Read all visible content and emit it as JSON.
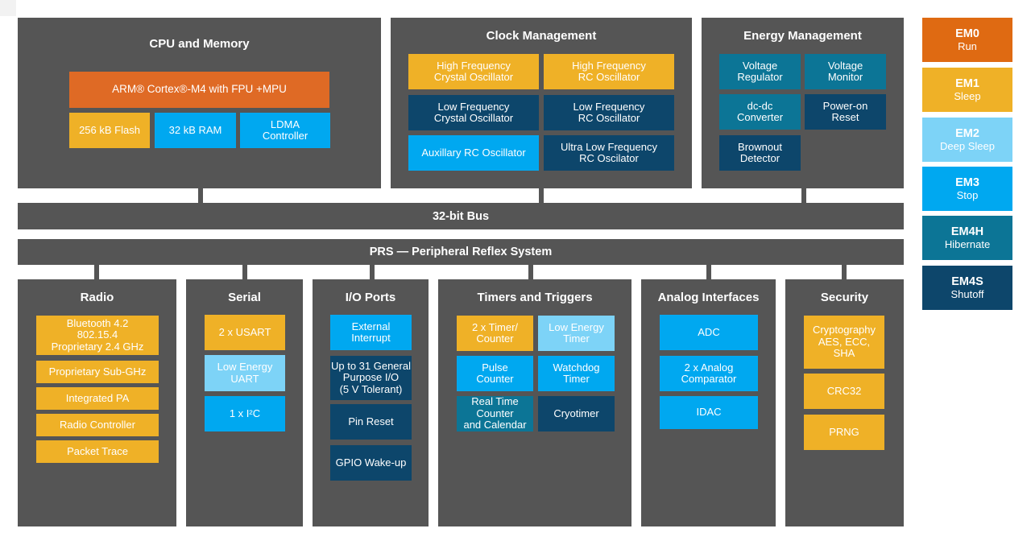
{
  "diagram": {
    "top_blocks": [
      {
        "title": "CPU and Memory",
        "tiles": [
          {
            "label": "ARM® Cortex®-M4 with FPU +MPU",
            "color": "#df6a25"
          },
          {
            "label": "256 kB Flash",
            "color": "#efb127"
          },
          {
            "label": "32 kB RAM",
            "color": "#00a8f0"
          },
          {
            "label": "LDMA\nController",
            "color": "#00a8f0"
          }
        ]
      },
      {
        "title": "Clock Management",
        "tiles": [
          {
            "label": "High Frequency\nCrystal Oscillator",
            "color": "#efb127"
          },
          {
            "label": "High Frequency\nRC Oscillator",
            "color": "#efb127"
          },
          {
            "label": "Low Frequency\nCrystal Oscillator",
            "color": "#0d466b"
          },
          {
            "label": "Low Frequency\nRC Oscillator",
            "color": "#0d466b"
          },
          {
            "label": "Auxillary RC Oscillator",
            "color": "#00a8f0"
          },
          {
            "label": "Ultra Low Frequency\nRC Oscilator",
            "color": "#0d466b"
          }
        ]
      },
      {
        "title": "Energy Management",
        "tiles": [
          {
            "label": "Voltage\nRegulator",
            "color": "#0c7596"
          },
          {
            "label": "Voltage\nMonitor",
            "color": "#0c7596"
          },
          {
            "label": "dc-dc\nConverter",
            "color": "#0c7596"
          },
          {
            "label": "Power-on\nReset",
            "color": "#0d466b"
          },
          {
            "label": "Brownout\nDetector",
            "color": "#0d466b"
          }
        ]
      }
    ],
    "bus_label": "32-bit Bus",
    "prs_label": "PRS — Peripheral Reflex System",
    "bottom_blocks": [
      {
        "title": "Radio",
        "tiles": [
          {
            "label": "Bluetooth 4.2\n802.15.4\nProprietary 2.4 GHz",
            "color": "#efb127"
          },
          {
            "label": "Proprietary Sub-GHz",
            "color": "#efb127"
          },
          {
            "label": "Integrated PA",
            "color": "#efb127"
          },
          {
            "label": "Radio Controller",
            "color": "#efb127"
          },
          {
            "label": "Packet Trace",
            "color": "#efb127"
          }
        ]
      },
      {
        "title": "Serial",
        "tiles": [
          {
            "label": "2 x USART",
            "color": "#efb127"
          },
          {
            "label": "Low Energy\nUART",
            "color": "#7dd3f7"
          },
          {
            "label": "1 x I²C",
            "color": "#00a8f0"
          }
        ]
      },
      {
        "title": "I/O Ports",
        "tiles": [
          {
            "label": "External\nInterrupt",
            "color": "#00a8f0"
          },
          {
            "label": "Up to 31 General\nPurpose I/O\n(5 V Tolerant)",
            "color": "#0d466b"
          },
          {
            "label": "Pin Reset",
            "color": "#0d466b"
          },
          {
            "label": "GPIO Wake-up",
            "color": "#0d466b"
          }
        ]
      },
      {
        "title": "Timers and Triggers",
        "tiles": [
          {
            "label": "2 x Timer/\nCounter",
            "color": "#efb127"
          },
          {
            "label": "Low Energy\nTimer",
            "color": "#7dd3f7"
          },
          {
            "label": "Pulse\nCounter",
            "color": "#00a8f0"
          },
          {
            "label": "Watchdog\nTimer",
            "color": "#00a8f0"
          },
          {
            "label": "Real Time\nCounter\nand Calendar",
            "color": "#0c7596"
          },
          {
            "label": "Cryotimer",
            "color": "#0d466b"
          }
        ]
      },
      {
        "title": "Analog Interfaces",
        "tiles": [
          {
            "label": "ADC",
            "color": "#00a8f0"
          },
          {
            "label": "2 x Analog\nComparator",
            "color": "#00a8f0"
          },
          {
            "label": "IDAC",
            "color": "#00a8f0"
          }
        ]
      },
      {
        "title": "Security",
        "tiles": [
          {
            "label": "Cryptography\nAES, ECC,\nSHA",
            "color": "#efb127"
          },
          {
            "label": "CRC32",
            "color": "#efb127"
          },
          {
            "label": "PRNG",
            "color": "#efb127"
          }
        ]
      }
    ]
  },
  "energy_modes": [
    {
      "code": "EM0",
      "label": "Run",
      "color": "#df6a12"
    },
    {
      "code": "EM1",
      "label": "Sleep",
      "color": "#efb127"
    },
    {
      "code": "EM2",
      "label": "Deep Sleep",
      "color": "#7dd3f7"
    },
    {
      "code": "EM3",
      "label": "Stop",
      "color": "#00a8f0"
    },
    {
      "code": "EM4H",
      "label": "Hibernate",
      "color": "#0c7596"
    },
    {
      "code": "EM4S",
      "label": "Shutoff",
      "color": "#0d466b"
    }
  ]
}
